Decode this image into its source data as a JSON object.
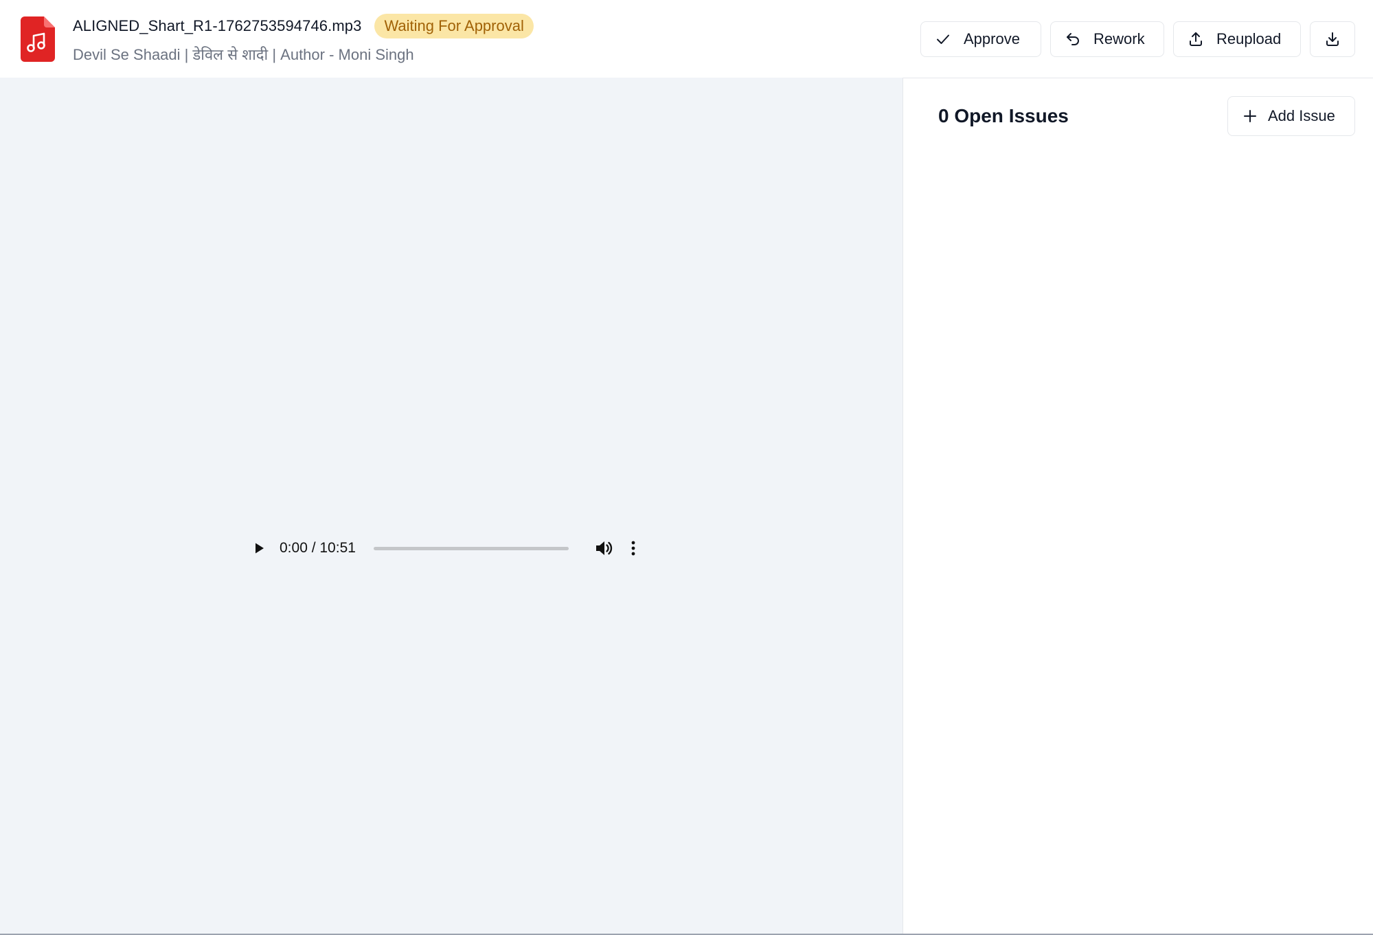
{
  "header": {
    "file_name": "ALIGNED_Shart_R1-1762753594746.mp3",
    "status": "Waiting For Approval",
    "subtitle": "Devil Se Shaadi | डेविल से शादी | Author - Moni Singh",
    "file_icon": "music-file-icon",
    "accent_color": "#e02424",
    "status_bg": "#fbe6a6",
    "status_color": "#a16207"
  },
  "actions": {
    "approve_label": "Approve",
    "rework_label": "Rework",
    "reupload_label": "Reupload",
    "approve_icon": "check-icon",
    "rework_icon": "undo-icon",
    "reupload_icon": "upload-icon",
    "download_icon": "download-icon"
  },
  "player": {
    "time": "0:00 / 10:51",
    "progress": 0,
    "play_icon": "play-icon",
    "volume_icon": "volume-icon",
    "more_icon": "more-vertical-icon"
  },
  "issues": {
    "title": "0 Open Issues",
    "add_label": "Add Issue",
    "add_icon": "plus-icon"
  }
}
